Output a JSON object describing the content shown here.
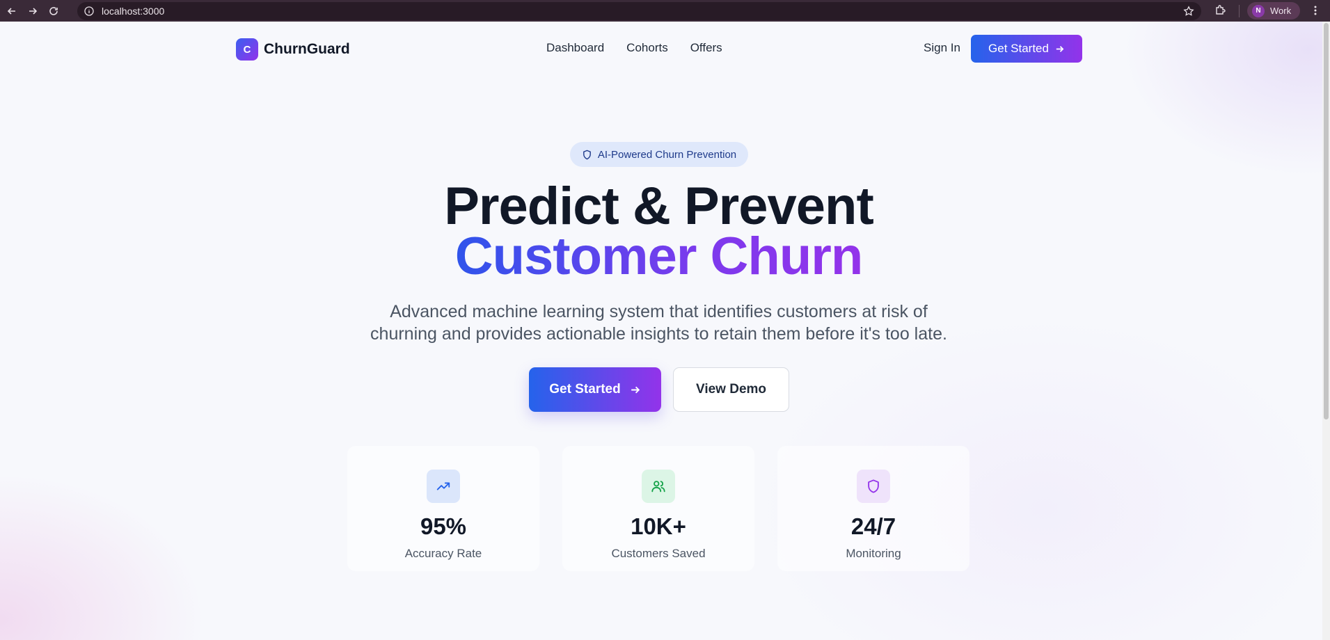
{
  "browser": {
    "url": "localhost:3000",
    "profile_initial": "N",
    "profile_name": "Work"
  },
  "header": {
    "brand_initial": "C",
    "brand_name": "ChurnGuard",
    "nav": [
      "Dashboard",
      "Cohorts",
      "Offers"
    ],
    "sign_in": "Sign In",
    "cta": "Get Started"
  },
  "hero": {
    "badge": "AI-Powered Churn Prevention",
    "title_line1": "Predict & Prevent",
    "title_line2": "Customer Churn",
    "subtitle_line1": "Advanced machine learning system that identifies customers at risk of",
    "subtitle_line2": "churning and provides actionable insights to retain them before it's too late.",
    "primary_button": "Get Started",
    "secondary_button": "View Demo"
  },
  "stats": [
    {
      "value": "95%",
      "label": "Accuracy Rate",
      "icon": "trending-up-icon",
      "color": "#2563eb",
      "bg": "#dbe6fb"
    },
    {
      "value": "10K+",
      "label": "Customers Saved",
      "icon": "users-icon",
      "color": "#16a34a",
      "bg": "#dcf5e6"
    },
    {
      "value": "24/7",
      "label": "Monitoring",
      "icon": "shield-icon",
      "color": "#9333ea",
      "bg": "#efe3fb"
    }
  ],
  "colors": {
    "accent_start": "#2563eb",
    "accent_end": "#9333ea",
    "chrome_bg": "#3a2a38"
  }
}
